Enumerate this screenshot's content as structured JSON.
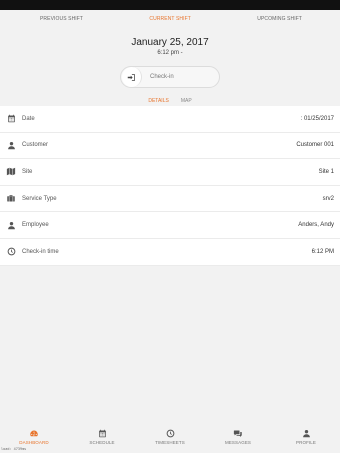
{
  "shift_tabs": {
    "previous": "PREVIOUS SHIFT",
    "current": "CURRENT SHIFT",
    "upcoming": "UPCOMING SHIFT"
  },
  "shift": {
    "date": "January 25, 2017",
    "time": "6:12 pm -"
  },
  "checkin": {
    "label": "Check-in"
  },
  "detail_tabs": {
    "details": "DETAILS",
    "map": "MAP"
  },
  "details": [
    {
      "icon": "calendar-icon",
      "label": "Date",
      "value": ": 01/25/2017"
    },
    {
      "icon": "person-icon",
      "label": "Customer",
      "value": "Customer 001"
    },
    {
      "icon": "map-icon",
      "label": "Site",
      "value": "Site 1"
    },
    {
      "icon": "briefcase-icon",
      "label": "Service Type",
      "value": "srv2"
    },
    {
      "icon": "person-icon",
      "label": "Employee",
      "value": "Anders, Andy"
    },
    {
      "icon": "clock-icon",
      "label": "Check-in time",
      "value": "6:12 PM"
    }
  ],
  "nav": {
    "dashboard": "DASHBOARD",
    "schedule": "SCHEDULE",
    "timesheets": "TIMESHEETS",
    "messages": "MESSAGES",
    "profile": "PROFILE"
  },
  "load_text": "load: 4739ms",
  "colors": {
    "accent": "#e8742c",
    "icon": "#555555"
  }
}
